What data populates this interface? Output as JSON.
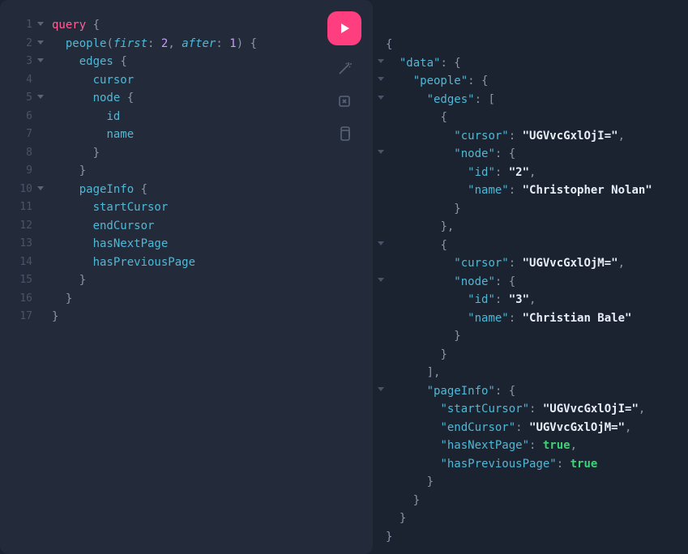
{
  "query": {
    "keyword": "query",
    "field": "people",
    "args": {
      "first": "first",
      "firstVal": "2",
      "after": "after",
      "afterVal": "1"
    },
    "edges": "edges",
    "cursor": "cursor",
    "node": "node",
    "id": "id",
    "name": "name",
    "pageInfo": "pageInfo",
    "startCursor": "startCursor",
    "endCursor": "endCursor",
    "hasNextPage": "hasNextPage",
    "hasPreviousPage": "hasPreviousPage"
  },
  "response": {
    "dataKey": "\"data\"",
    "peopleKey": "\"people\"",
    "edgesKey": "\"edges\"",
    "cursorKey": "\"cursor\"",
    "nodeKey": "\"node\"",
    "idKey": "\"id\"",
    "nameKey": "\"name\"",
    "pageInfoKey": "\"pageInfo\"",
    "startCursorKey": "\"startCursor\"",
    "endCursorKey": "\"endCursor\"",
    "hasNextPageKey": "\"hasNextPage\"",
    "hasPreviousPageKey": "\"hasPreviousPage\"",
    "edge1": {
      "cursor": "\"UGVvcGxlOjI=\"",
      "id": "\"2\"",
      "name": "\"Christopher Nolan\""
    },
    "edge2": {
      "cursor": "\"UGVvcGxlOjM=\"",
      "id": "\"3\"",
      "name": "\"Christian Bale\""
    },
    "pageInfo": {
      "startCursor": "\"UGVvcGxlOjI=\"",
      "endCursor": "\"UGVvcGxlOjM=\"",
      "hasNextPage": "true",
      "hasPreviousPage": "true"
    }
  },
  "lineNumbers": [
    "1",
    "2",
    "3",
    "4",
    "5",
    "6",
    "7",
    "8",
    "9",
    "10",
    "11",
    "12",
    "13",
    "14",
    "15",
    "16",
    "17"
  ],
  "foldLines": [
    1,
    2,
    3,
    5,
    10
  ]
}
